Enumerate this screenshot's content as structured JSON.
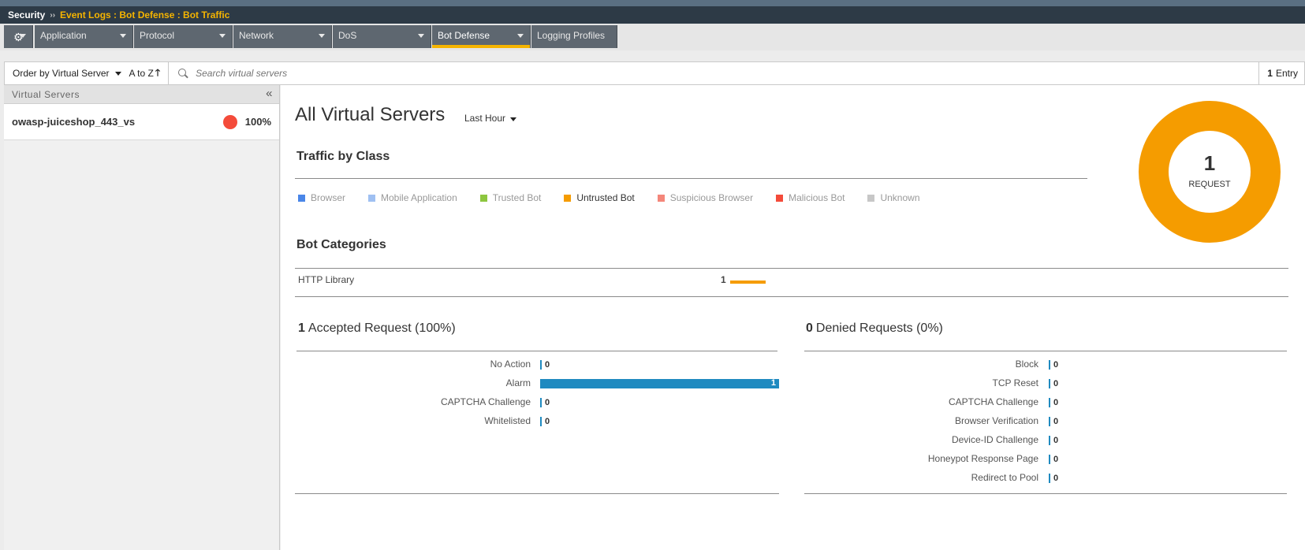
{
  "titlebar": {
    "root": "Security",
    "separator": "››",
    "crumb": "Event Logs : Bot Defense : Bot Traffic"
  },
  "menu": {
    "items": [
      {
        "label": "Application"
      },
      {
        "label": "Protocol"
      },
      {
        "label": "Network"
      },
      {
        "label": "DoS"
      },
      {
        "label": "Bot Defense",
        "active": true
      },
      {
        "label": "Logging Profiles"
      }
    ]
  },
  "toolbar": {
    "order_label": "Order by Virtual Server",
    "sort_label": "A to Z",
    "sort_arrow": "🡑",
    "search_placeholder": "Search virtual servers",
    "entries_count": "1",
    "entries_label": "Entry"
  },
  "left_panel": {
    "header": "Virtual Servers",
    "collapse": "«",
    "servers": [
      {
        "name": "owasp-juiceshop_443_vs",
        "percent": "100%",
        "status_color": "#f44b3a"
      }
    ]
  },
  "main": {
    "title": "All Virtual Servers",
    "period": "Last Hour",
    "traffic_title": "Traffic by Class",
    "legend": [
      {
        "label": "Browser",
        "color": "#4a86e8"
      },
      {
        "label": "Mobile Application",
        "color": "#9fc0f2"
      },
      {
        "label": "Trusted Bot",
        "color": "#8dc63f"
      },
      {
        "label": "Untrusted Bot",
        "color": "#f59c00",
        "active": true
      },
      {
        "label": "Suspicious Browser",
        "color": "#f4867a"
      },
      {
        "label": "Malicious Bot",
        "color": "#f44b3a"
      },
      {
        "label": "Unknown",
        "color": "#c7c7c7"
      }
    ],
    "categories_title": "Bot Categories",
    "categories": [
      {
        "label": "HTTP Library",
        "value": "1"
      }
    ],
    "accepted": {
      "count": "1",
      "label": "Accepted Request (100%)",
      "rows": [
        {
          "label": "No Action",
          "value": "0"
        },
        {
          "label": "Alarm",
          "value": "1"
        },
        {
          "label": "CAPTCHA Challenge",
          "value": "0"
        },
        {
          "label": "Whitelisted",
          "value": "0"
        }
      ]
    },
    "denied": {
      "count": "0",
      "label": "Denied Requests (0%)",
      "rows": [
        {
          "label": "Block",
          "value": "0"
        },
        {
          "label": "TCP Reset",
          "value": "0"
        },
        {
          "label": "CAPTCHA Challenge",
          "value": "0"
        },
        {
          "label": "Browser Verification",
          "value": "0"
        },
        {
          "label": "Device-ID Challenge",
          "value": "0"
        },
        {
          "label": "Honeypot Response Page",
          "value": "0"
        },
        {
          "label": "Redirect to Pool",
          "value": "0"
        }
      ]
    },
    "donut": {
      "value": "1",
      "label": "REQUEST",
      "color": "#f59c00"
    }
  }
}
